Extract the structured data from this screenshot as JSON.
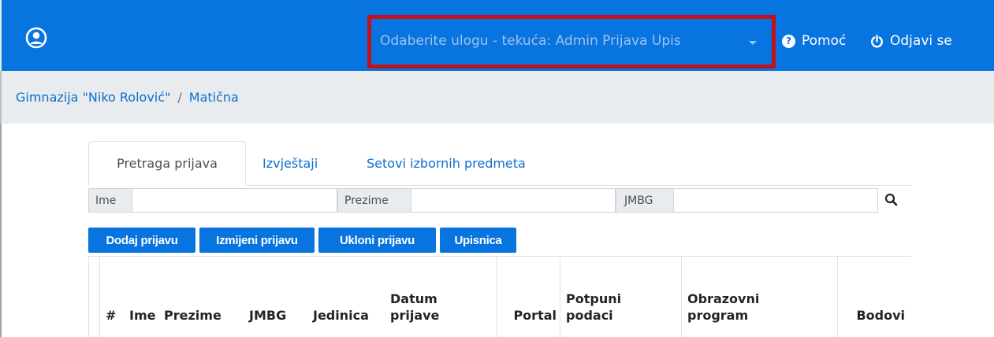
{
  "navbar": {
    "role_select": "Odaberite ulogu - tekuća: Admin Prijava Upis",
    "help": "Pomoć",
    "logout": "Odjavi se",
    "colors": {
      "background": "#0874e0",
      "highlight_border": "#c1121b"
    }
  },
  "breadcrumb": {
    "school": "Gimnazija \"Niko Rolović\"",
    "separator": "/",
    "current": "Matična"
  },
  "tabs": [
    {
      "label": "Pretraga prijava",
      "active": true
    },
    {
      "label": "Izvještaji",
      "active": false
    },
    {
      "label": "Setovi izbornih predmeta",
      "active": false
    }
  ],
  "search": {
    "fields": [
      {
        "label": "Ime",
        "value": ""
      },
      {
        "label": "Prezime",
        "value": ""
      },
      {
        "label": "JMBG",
        "value": ""
      }
    ],
    "icon": "search-icon"
  },
  "buttons": {
    "add": "Dodaj prijavu",
    "edit": "Izmijeni prijavu",
    "remove": "Ukloni prijavu",
    "enrollment": "Upisnica"
  },
  "table": {
    "columns": [
      {
        "line1": "",
        "line2": "#"
      },
      {
        "line1": "",
        "line2": "Ime"
      },
      {
        "line1": "",
        "line2": "Prezime"
      },
      {
        "line1": "",
        "line2": "JMBG"
      },
      {
        "line1": "",
        "line2": "Jedinica"
      },
      {
        "line1": "Datum",
        "line2": "prijave"
      },
      {
        "line1": "",
        "line2": "Portal"
      },
      {
        "line1": "Potpuni",
        "line2": "podaci"
      },
      {
        "line1": "Obrazovni",
        "line2": "program"
      },
      {
        "line1": "",
        "line2": "Bodovi"
      }
    ],
    "rows": []
  }
}
